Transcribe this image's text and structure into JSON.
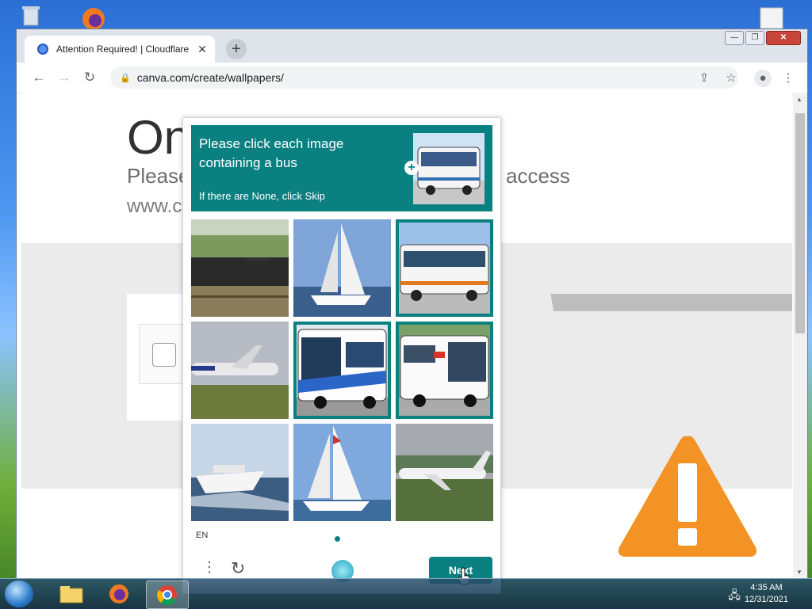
{
  "browser": {
    "tab_title": "Attention Required! | Cloudflare",
    "tab_close": "✕",
    "new_tab": "+",
    "url": "canva.com/create/wallpapers/",
    "window_buttons": {
      "minimize": "—",
      "restore": "❐",
      "close": "✕"
    }
  },
  "page": {
    "heading": "On",
    "subtitle": "Please",
    "subtitle_right": "access",
    "domain_text": "www.c"
  },
  "captcha": {
    "prompt": "Please click each image containing a bus",
    "skip_hint": "If there are None, click Skip",
    "language": "EN",
    "next_label": "Next",
    "tiles": [
      {
        "content": "train",
        "selected": false
      },
      {
        "content": "sailboat",
        "selected": false
      },
      {
        "content": "bus",
        "selected": true
      },
      {
        "content": "airplane",
        "selected": false
      },
      {
        "content": "bus",
        "selected": true
      },
      {
        "content": "bus",
        "selected": true
      },
      {
        "content": "motorboat",
        "selected": false
      },
      {
        "content": "sailboat",
        "selected": false
      },
      {
        "content": "airplane",
        "selected": false
      }
    ],
    "accent_color": "#0b8081"
  },
  "taskbar": {
    "time": "4:35 AM",
    "date": "12/31/2021"
  },
  "colors": {
    "warning": "#f39325"
  }
}
